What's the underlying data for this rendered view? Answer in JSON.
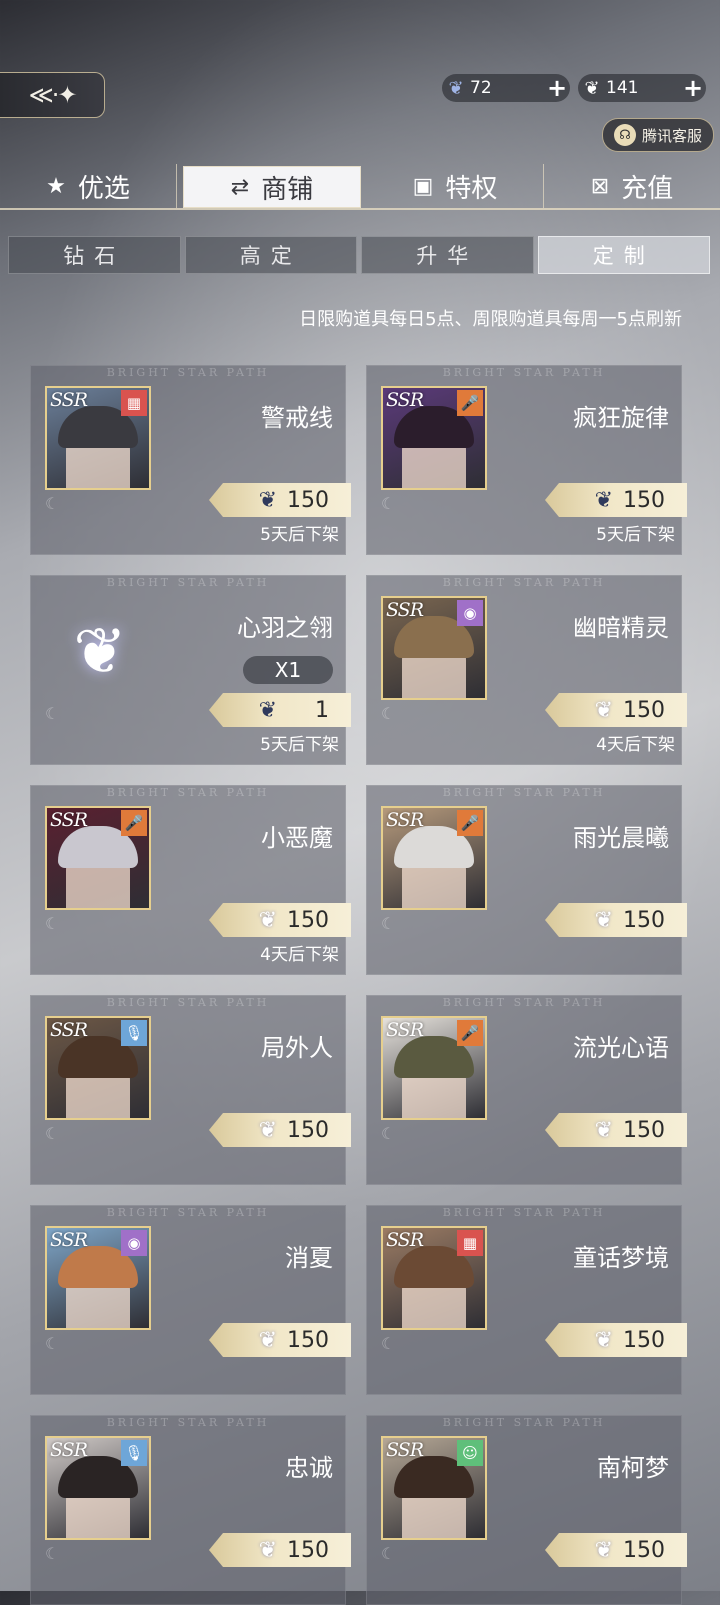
{
  "topbar": {
    "back_icon": "back-arrow-icon",
    "currencies": [
      {
        "name": "blue-feather-icon",
        "value": "72",
        "plus": "+"
      },
      {
        "name": "white-feather-icon",
        "value": "141",
        "plus": "+"
      }
    ],
    "support_label": "腾讯客服"
  },
  "main_tabs": [
    {
      "label": "优选",
      "icon": "star-icon",
      "glyph": "★"
    },
    {
      "label": "商铺",
      "icon": "exchange-icon",
      "glyph": "⇄"
    },
    {
      "label": "特权",
      "icon": "privilege-icon",
      "glyph": "▣"
    },
    {
      "label": "充值",
      "icon": "recharge-icon",
      "glyph": "⊠"
    }
  ],
  "active_main_tab": 1,
  "sub_tabs": [
    {
      "label": "钻石"
    },
    {
      "label": "高定"
    },
    {
      "label": "升华"
    },
    {
      "label": "定制"
    }
  ],
  "active_sub_tab": 3,
  "notice": "日限购道具每日5点、周限购道具每周一5点刷新",
  "watermark": "BRIGHT STAR PATH",
  "rarity": "SSR",
  "items": [
    {
      "name": "警戒线",
      "type_icon": "film-icon",
      "type_glyph": "▦",
      "type_color": "#d9534f",
      "hair": "#3a3a40",
      "bg": "#6b7f99",
      "price": "150",
      "currency": "blue",
      "expire": "5天后下架"
    },
    {
      "name": "疯狂旋律",
      "type_icon": "microphone-icon",
      "type_glyph": "🎤",
      "type_color": "#e07a3a",
      "hair": "#2b1d2c",
      "bg": "#5b3a7a",
      "price": "150",
      "currency": "blue",
      "expire": "5天后下架"
    },
    {
      "name": "心羽之翎",
      "is_feather": true,
      "qty": "X1",
      "price": "1",
      "currency": "blue",
      "expire": "5天后下架"
    },
    {
      "name": "幽暗精灵",
      "type_icon": "vinyl-icon",
      "type_glyph": "◉",
      "type_color": "#a070c8",
      "hair": "#8a6f4e",
      "bg": "#7a6650",
      "price": "150",
      "currency": "white",
      "expire": "4天后下架"
    },
    {
      "name": "小恶魔",
      "type_icon": "microphone-icon",
      "type_glyph": "🎤",
      "type_color": "#e07a3a",
      "hair": "#c9c7cf",
      "bg": "#5a2030",
      "price": "150",
      "currency": "white",
      "expire": "4天后下架"
    },
    {
      "name": "雨光晨曦",
      "type_icon": "microphone-icon",
      "type_glyph": "🎤",
      "type_color": "#e07a3a",
      "hair": "#dcdad8",
      "bg": "#b69a7c",
      "price": "150",
      "currency": "white",
      "expire": ""
    },
    {
      "name": "局外人",
      "type_icon": "microphone-small-icon",
      "type_glyph": "🎙",
      "type_color": "#6ea6d8",
      "hair": "#4a3426",
      "bg": "#6d5846",
      "price": "150",
      "currency": "white",
      "expire": ""
    },
    {
      "name": "流光心语",
      "type_icon": "microphone-icon",
      "type_glyph": "🎤",
      "type_color": "#e07a3a",
      "hair": "#5a5a40",
      "bg": "#e6e2dc",
      "price": "150",
      "currency": "white",
      "expire": ""
    },
    {
      "name": "消夏",
      "type_icon": "vinyl-icon",
      "type_glyph": "◉",
      "type_color": "#a070c8",
      "hair": "#c07a4a",
      "bg": "#7fa6c8",
      "price": "150",
      "currency": "white",
      "expire": ""
    },
    {
      "name": "童话梦境",
      "type_icon": "film-icon",
      "type_glyph": "▦",
      "type_color": "#d9534f",
      "hair": "#6b4a34",
      "bg": "#9c7c64",
      "price": "150",
      "currency": "white",
      "expire": ""
    },
    {
      "name": "忠诚",
      "type_icon": "microphone-small-icon",
      "type_glyph": "🎙",
      "type_color": "#6ea6d8",
      "hair": "#2a2424",
      "bg": "#cfc9c6",
      "price": "150",
      "currency": "white",
      "expire": ""
    },
    {
      "name": "南柯梦",
      "type_icon": "smile-icon",
      "type_glyph": "☺",
      "type_color": "#5fbf7a",
      "hair": "#3a2a22",
      "bg": "#b6a896",
      "price": "150",
      "currency": "white",
      "expire": ""
    }
  ]
}
